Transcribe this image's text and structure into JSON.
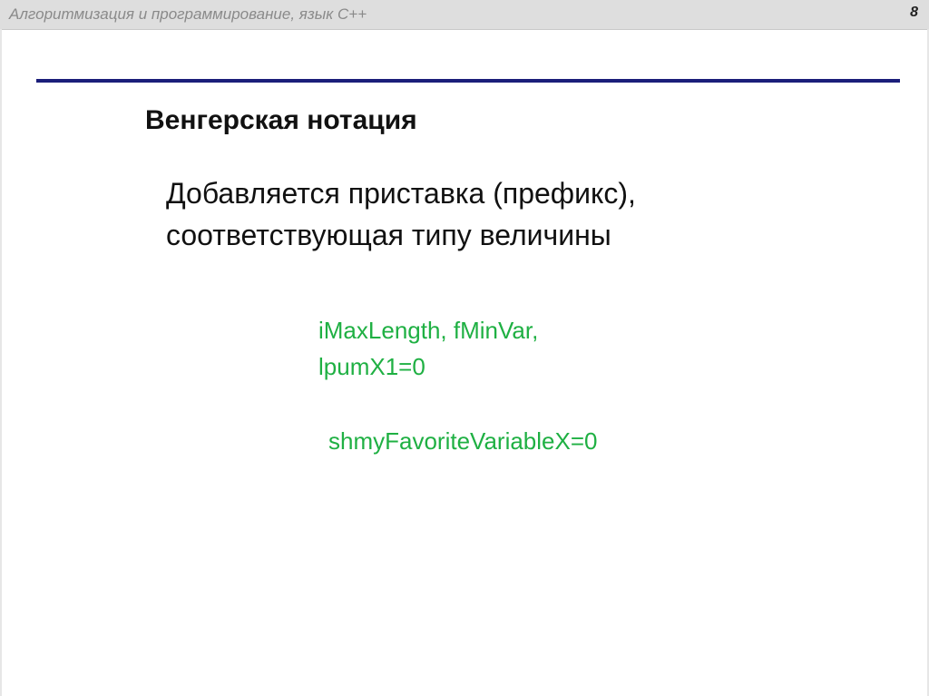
{
  "header": {
    "course_title": "Алгоритмизация и программирование, язык С++",
    "page_number": "8"
  },
  "slide": {
    "title": "Венгерская нотация",
    "body_lines": [
      "Добавляется приставка (префикс),",
      "соответствующая типу величины"
    ],
    "code_lines": [
      "iMaxLength,  fMinVar,",
      "lpumX1=0"
    ],
    "code_line_extra": "shmyFavoriteVariableX=0"
  },
  "colors": {
    "rule": "#1b1e7a",
    "code_text": "#1fb043",
    "header_bg": "#dedede"
  }
}
